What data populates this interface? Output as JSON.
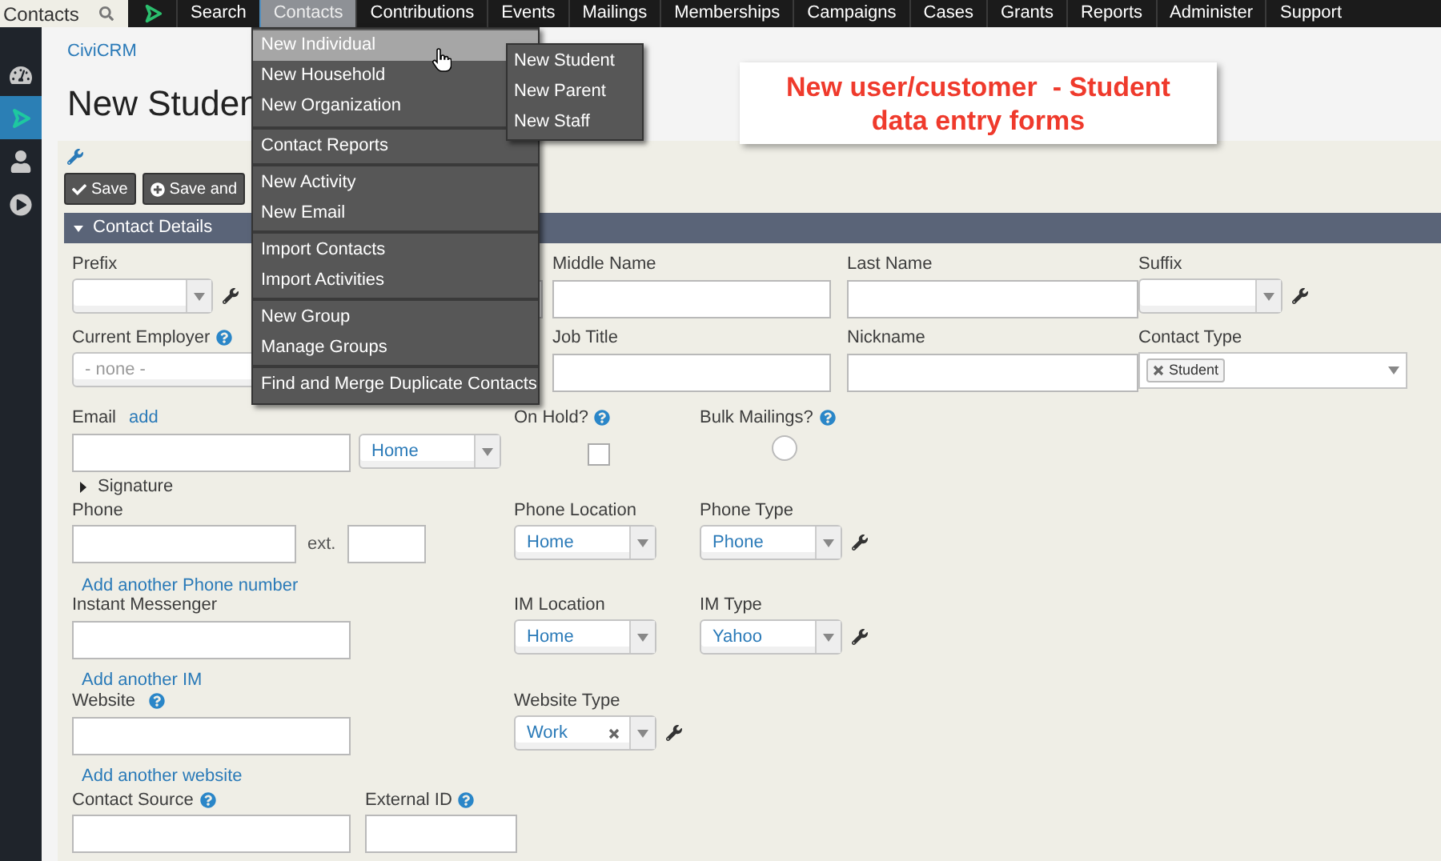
{
  "search": {
    "placeholder": "Contacts"
  },
  "nav": [
    {
      "label": "Search",
      "selected": false
    },
    {
      "label": "Contacts",
      "selected": true
    },
    {
      "label": "Contributions",
      "selected": false
    },
    {
      "label": "Events",
      "selected": false
    },
    {
      "label": "Mailings",
      "selected": false
    },
    {
      "label": "Memberships",
      "selected": false
    },
    {
      "label": "Campaigns",
      "selected": false
    },
    {
      "label": "Cases",
      "selected": false
    },
    {
      "label": "Grants",
      "selected": false
    },
    {
      "label": "Reports",
      "selected": false
    },
    {
      "label": "Administer",
      "selected": false
    },
    {
      "label": "Support",
      "selected": false
    }
  ],
  "sidebar": [
    {
      "kind": "dashboard",
      "selected": false
    },
    {
      "kind": "logo",
      "selected": true
    },
    {
      "kind": "person",
      "selected": false
    },
    {
      "kind": "play",
      "selected": false
    }
  ],
  "breadcrumb": "CiviCRM",
  "page_title": "New Studen",
  "callout": "New user/customer  - Student data entry forms",
  "buttons": [
    {
      "label": "Save",
      "kind": "check"
    },
    {
      "label": "Save and",
      "kind": "plus"
    }
  ],
  "section": {
    "title": "Contact Details",
    "expanded": true
  },
  "form": {
    "prefix": {
      "label": "Prefix"
    },
    "middle_name": {
      "label": "Middle Name"
    },
    "last_name": {
      "label": "Last Name"
    },
    "suffix": {
      "label": "Suffix"
    },
    "current_employer": {
      "label": "Current Employer",
      "help": true,
      "placeholder": "- none -"
    },
    "job_title": {
      "label": "Job Title"
    },
    "nickname": {
      "label": "Nickname"
    },
    "contact_type": {
      "label": "Contact Type",
      "tags": [
        "Student"
      ]
    },
    "email": {
      "label": "Email",
      "add_link": "add",
      "location": "Home"
    },
    "on_hold": {
      "label": "On Hold?",
      "help": true,
      "checked": false
    },
    "bulk_mailings": {
      "label": "Bulk Mailings?",
      "help": true,
      "selected": false
    },
    "signature": {
      "label": "Signature",
      "expanded": false
    },
    "phone": {
      "label": "Phone",
      "ext_label": "ext.",
      "location_label": "Phone Location",
      "location": "Home",
      "type_label": "Phone Type",
      "type": "Phone",
      "add_link": "Add another Phone number"
    },
    "im": {
      "label": "Instant Messenger",
      "location_label": "IM Location",
      "location": "Home",
      "type_label": "IM Type",
      "type": "Yahoo",
      "add_link": "Add another IM"
    },
    "website": {
      "label": "Website",
      "help": true,
      "type_label": "Website Type",
      "type": "Work",
      "add_link": "Add another website"
    },
    "contact_source": {
      "label": "Contact Source",
      "help": true
    },
    "external_id": {
      "label": "External ID",
      "help": true
    }
  },
  "menu": {
    "groups": [
      {
        "items": [
          {
            "label": "New Individual",
            "selected": true
          },
          {
            "label": "New Household",
            "selected": false
          },
          {
            "label": "New Organization",
            "selected": false
          }
        ]
      },
      {
        "items": [
          {
            "label": "Contact Reports",
            "selected": false
          }
        ]
      },
      {
        "items": [
          {
            "label": "New Activity",
            "selected": false
          },
          {
            "label": "New Email",
            "selected": false
          }
        ]
      },
      {
        "items": [
          {
            "label": "Import Contacts",
            "selected": false
          },
          {
            "label": "Import Activities",
            "selected": false
          }
        ]
      },
      {
        "items": [
          {
            "label": "New Group",
            "selected": false
          },
          {
            "label": "Manage Groups",
            "selected": false
          }
        ]
      },
      {
        "items": [
          {
            "label": "Find and Merge Duplicate Contacts",
            "selected": false
          }
        ]
      }
    ]
  },
  "submenu": {
    "items": [
      {
        "label": "New Student"
      },
      {
        "label": "New Parent"
      },
      {
        "label": "New Staff"
      }
    ]
  }
}
